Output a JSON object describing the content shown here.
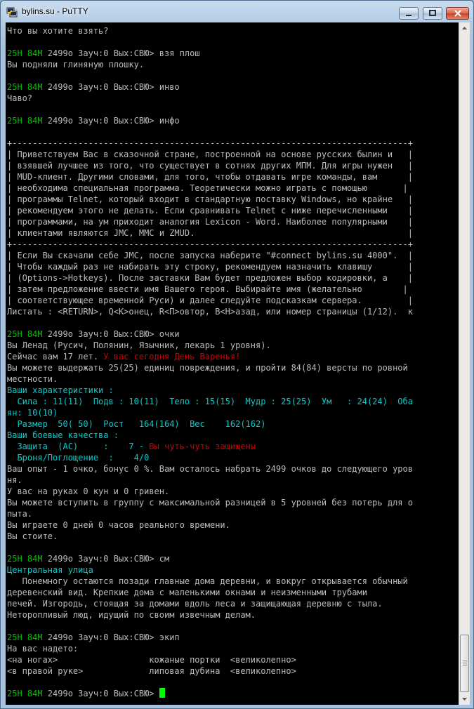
{
  "window": {
    "title": "bylins.su - PuTTY"
  },
  "colors": {
    "prompt": "#00bb00",
    "highlight": "#00cdcd",
    "alert": "#cd0000",
    "text": "#bbbbbb",
    "cursor": "#00ff00"
  },
  "icons": {
    "app": "putty-icon",
    "minimize": "minimize-icon",
    "maximize": "maximize-icon",
    "close": "close-icon"
  },
  "terminal": {
    "lines": [
      [
        {
          "t": "Что вы хотите взять?"
        }
      ],
      [
        {
          "t": ""
        }
      ],
      [
        {
          "t": "25H 84M",
          "s": "g"
        },
        {
          "t": " 2499o Зауч:0 Вых:СВЮ> взя плош"
        }
      ],
      [
        {
          "t": "Вы подняли глиняную плошку."
        }
      ],
      [
        {
          "t": ""
        }
      ],
      [
        {
          "t": "25H 84M",
          "s": "g"
        },
        {
          "t": " 2499o Зауч:0 Вых:СВЮ> инво"
        }
      ],
      [
        {
          "t": "Чаво?"
        }
      ],
      [
        {
          "t": ""
        }
      ],
      [
        {
          "t": "25H 84M",
          "s": "g"
        },
        {
          "t": " 2499o Зауч:0 Вых:СВЮ> инфо"
        }
      ],
      [
        {
          "t": ""
        }
      ],
      [
        {
          "t": "+------------------------------------------------------------------------------+"
        }
      ],
      [
        {
          "t": "| Приветствуем Вас в сказочной стране, построенной на основе русских былин и   |"
        }
      ],
      [
        {
          "t": "| взявшей лучшее из того, что существует в сотнях других МПМ. Для игры нужен   |"
        }
      ],
      [
        {
          "t": "| MUD-клиент. Другими словами, для того, чтобы отдавать игре команды, вам      |"
        }
      ],
      [
        {
          "t": "| необходима специальная программа. Теоретически можно играть с помощью       |"
        }
      ],
      [
        {
          "t": "| программы Telnet, который входит в стандартную поставку Windows, но крайне   |"
        }
      ],
      [
        {
          "t": "| рекомендуем этого не делать. Если сравнивать Telnet с ниже перечисленными    |"
        }
      ],
      [
        {
          "t": "| программами, на ум приходит аналогия Lexicon - Word. Наиболее популярными    |"
        }
      ],
      [
        {
          "t": "| клиентами являются JMC, MMC и ZMUD.                                          |"
        }
      ],
      [
        {
          "t": "+------------------------------------------------------------------------------+"
        }
      ],
      [
        {
          "t": "| Если Вы скачали себе JMC, после запуска наберите \"#connect bylins.su 4000\".  |"
        }
      ],
      [
        {
          "t": "| Чтобы каждый раз не набирать эту строку, рекомендуем назначить клавишу       |"
        }
      ],
      [
        {
          "t": "| (Options->Hotkeys). После заставки Вам будет предложен выбор кодировки, а    |"
        }
      ],
      [
        {
          "t": "| затем предложение ввести имя Вашего героя. Выбирайте имя (желательно        |"
        }
      ],
      [
        {
          "t": "| соответствующее временной Руси) и далее следуйте подсказкам сервера.         |"
        }
      ],
      [
        {
          "t": "Листать : <RETURN>, Q<K>онец, R<П>овтор, B<Н>азад, или номер страницы (1/12).  к"
        }
      ],
      [
        {
          "t": ""
        }
      ],
      [
        {
          "t": "25H 84M",
          "s": "g"
        },
        {
          "t": " 2499o Зауч:0 Вых:СВЮ> очки"
        }
      ],
      [
        {
          "t": "Вы Ленад (Русич, Полянин, Язычник, лекарь 1 уровня)."
        }
      ],
      [
        {
          "t": "Сейчас вам 17 лет. "
        },
        {
          "t": "У вас сегодня День Варенья!",
          "s": "r"
        }
      ],
      [
        {
          "t": "Вы можете выдержать 25(25) единиц повреждения, и пройти 84(84) версты по ровной"
        }
      ],
      [
        {
          "t": "местности."
        }
      ],
      [
        {
          "t": "Ваши характеристики :",
          "s": "c"
        }
      ],
      [
        {
          "t": "  Сила : 11(11)  Подв : 10(11)  Тело : 15(15)  Мудр : 25(25)  Ум   : 24(24)  Оба",
          "s": "c"
        }
      ],
      [
        {
          "t": "ян: 10(10)",
          "s": "c"
        }
      ],
      [
        {
          "t": "  Размер  50( 50)  Рост   164(164)  Вес    162(162)",
          "s": "c"
        }
      ],
      [
        {
          "t": "Ваши боевые качества :",
          "s": "c"
        }
      ],
      [
        {
          "t": "  Защита  (AC)     :    7 - ",
          "s": "c"
        },
        {
          "t": "Вы чуть-чуть защищены",
          "s": "r"
        }
      ],
      [
        {
          "t": "  Броня/Поглощение  :    4/0",
          "s": "c"
        }
      ],
      [
        {
          "t": "Ваш опыт - 1 очко, бонус 0 %. Вам осталось набрать 2499 очков до следующего уров"
        }
      ],
      [
        {
          "t": "ня."
        }
      ],
      [
        {
          "t": "У вас на руках 0 кун и 0 гривен."
        }
      ],
      [
        {
          "t": "Вы можете вступить в группу с максимальной разницей в 5 уровней без потерь для о"
        }
      ],
      [
        {
          "t": "пыта."
        }
      ],
      [
        {
          "t": "Вы играете 0 дней 0 часов реального времени."
        }
      ],
      [
        {
          "t": "Вы стоите."
        }
      ],
      [
        {
          "t": ""
        }
      ],
      [
        {
          "t": "25H 84M",
          "s": "g"
        },
        {
          "t": " 2499o Зауч:0 Вых:СВЮ> см"
        }
      ],
      [
        {
          "t": "Центральная улица",
          "s": "c"
        }
      ],
      [
        {
          "t": "   Понемногу остаются позади главные дома деревни, и вокруг открывается обычный"
        }
      ],
      [
        {
          "t": "деревенский вид. Крепкие дома с маленькими окнами и неизменными трубами"
        }
      ],
      [
        {
          "t": "печей. Изгородь, стоящая за домами вдоль леса и защищающая деревню с тыла."
        }
      ],
      [
        {
          "t": "Неторопливый люд, идущий по своим извечным делам."
        }
      ],
      [
        {
          "t": ""
        }
      ],
      [
        {
          "t": "25H 84M",
          "s": "g"
        },
        {
          "t": " 2499o Зауч:0 Вых:СВЮ> экип"
        }
      ],
      [
        {
          "t": "На вас надето:"
        }
      ],
      [
        {
          "t": "<на ногах>                  кожаные портки  <великолепно>"
        }
      ],
      [
        {
          "t": "<в правой руке>             липовая дубина  <великолепно>"
        }
      ],
      [
        {
          "t": ""
        }
      ],
      [
        {
          "t": "25H 84M",
          "s": "g"
        },
        {
          "t": " 2499o Зауч:0 Вых:СВЮ> "
        }
      ]
    ]
  }
}
